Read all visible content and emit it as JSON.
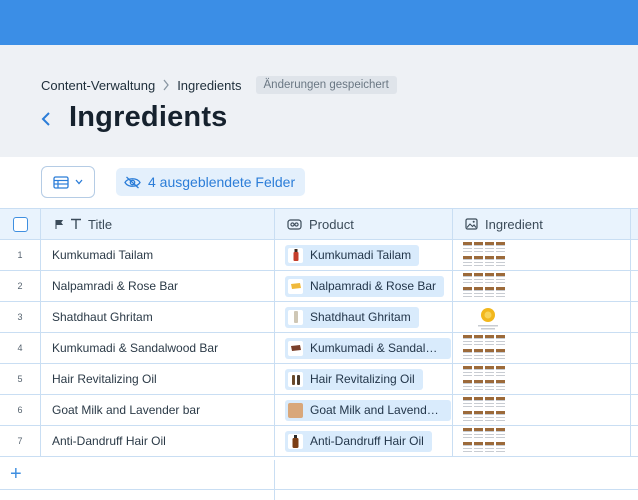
{
  "breadcrumb": {
    "items": [
      "Content-Verwaltung",
      "Ingredients"
    ],
    "status": "Änderungen gespeichert"
  },
  "page": {
    "title": "Ingredients"
  },
  "toolbar": {
    "hidden_fields": "4 ausgeblendete Felder"
  },
  "table": {
    "columns": {
      "title": "Title",
      "product": "Product",
      "ingredient": "Ingredient"
    },
    "rows": [
      {
        "num": "1",
        "title": "Kumkumadi Tailam",
        "product": "Kumkumadi Tailam"
      },
      {
        "num": "2",
        "title": "Nalpamradi & Rose Bar",
        "product": "Nalpamradi & Rose Bar"
      },
      {
        "num": "3",
        "title": "Shatdhaut Ghritam",
        "product": "Shatdhaut Ghritam"
      },
      {
        "num": "4",
        "title": "Kumkumadi & Sandalwood Bar",
        "product": "Kumkumadi & Sandalwood Bar"
      },
      {
        "num": "5",
        "title": "Hair Revitalizing Oil",
        "product": "Hair Revitalizing Oil"
      },
      {
        "num": "6",
        "title": "Goat Milk and Lavender bar",
        "product": "Goat Milk and Lavender bar"
      },
      {
        "num": "7",
        "title": "Anti-Dandruff Hair Oil",
        "product": "Anti-Dandruff Hair Oil"
      }
    ],
    "add_row": "+"
  }
}
